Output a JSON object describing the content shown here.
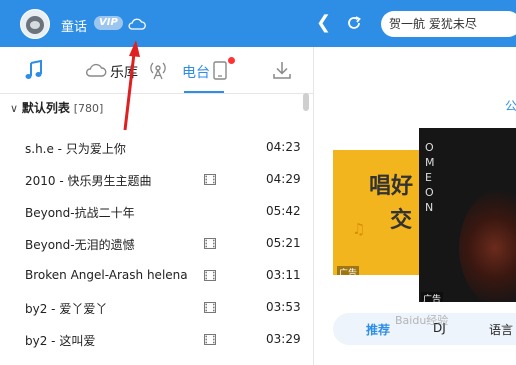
{
  "header": {
    "username": "童话",
    "vip_label": "VIP",
    "search_text": "贺一航 爱犹未尽",
    "icons": [
      "avatar",
      "cloud-icon",
      "back-icon",
      "refresh-icon"
    ]
  },
  "left_tabs": [
    "music-note-icon",
    "cloud-icon",
    "radio-icon",
    "device-icon",
    "download-icon"
  ],
  "list": {
    "title": "默认列表",
    "count": "[780]",
    "songs": [
      {
        "title": "s.h.e - 只为爱上你",
        "mv": false,
        "duration": "04:23"
      },
      {
        "title": "2010 - 快乐男生主题曲",
        "mv": true,
        "duration": "04:29"
      },
      {
        "title": "Beyond-抗战二十年",
        "mv": false,
        "duration": "05:42"
      },
      {
        "title": "Beyond-无泪的遗憾",
        "mv": true,
        "duration": "05:21"
      },
      {
        "title": "Broken Angel-Arash helena",
        "mv": true,
        "duration": "03:11"
      },
      {
        "title": "by2 - 爱丫爱丫",
        "mv": true,
        "duration": "03:53"
      },
      {
        "title": "by2 - 这叫爱",
        "mv": true,
        "duration": "03:29"
      }
    ]
  },
  "right": {
    "tab_library": "乐库",
    "tab_radio": "电台",
    "notice": "公",
    "banner1": {
      "text1": "唱好",
      "text2": "交",
      "ad": "广告"
    },
    "banner2": {
      "vertical_text": "OME ON",
      "ad": "广告"
    },
    "tags": {
      "recommend": "推荐",
      "dj": "DJ",
      "language": "语言"
    }
  },
  "watermark": "Baidu经验",
  "colors": {
    "accent": "#2e8ee6",
    "banner_yellow": "#f3b51d",
    "annotation_red": "#e02020"
  }
}
